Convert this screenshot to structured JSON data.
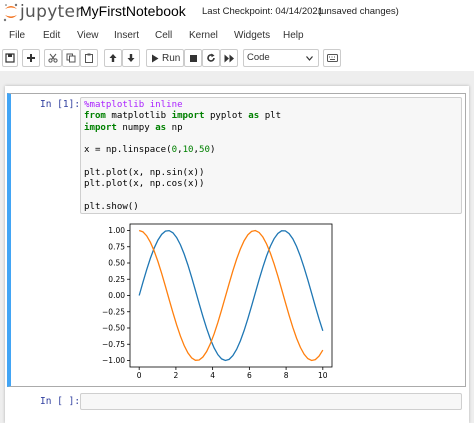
{
  "header": {
    "logo_text": "jupyter",
    "notebook_title": "MyFirstNotebook",
    "checkpoint": "Last Checkpoint: 04/14/2021",
    "save_status": "(unsaved changes)"
  },
  "menu": {
    "items": [
      "File",
      "Edit",
      "View",
      "Insert",
      "Cell",
      "Kernel",
      "Widgets",
      "Help"
    ]
  },
  "toolbar": {
    "run_label": "Run",
    "cell_type": "Code",
    "icons": [
      "save-icon",
      "plus-icon",
      "cut-icon",
      "copy-icon",
      "paste-icon",
      "arrow-up-icon",
      "arrow-down-icon",
      "run-icon",
      "stop-icon",
      "restart-icon",
      "fast-forward-icon",
      "keyboard-icon"
    ]
  },
  "cells": {
    "cell1_prompt": "In [1]:",
    "cell1_code": {
      "line1_magic": "%matplotlib inline",
      "line2_from": "from",
      "line2_mod": " matplotlib ",
      "line2_import": "import",
      "line2_rest": " pyplot ",
      "line2_as": "as",
      "line2_alias": " plt",
      "line3_import": "import",
      "line3_rest": " numpy ",
      "line3_as": "as",
      "line3_alias": " np",
      "line5_a": "x = np.linspace(",
      "line5_b": "0",
      "line5_c": ",",
      "line5_d": "10",
      "line5_e": ",",
      "line5_f": "50",
      "line5_g": ")",
      "line7": "plt.plot(x, np.sin(x))",
      "line8": "plt.plot(x, np.cos(x))",
      "line10": "plt.show()"
    },
    "cell2_prompt": "In [ ]:"
  },
  "chart_data": {
    "type": "line",
    "x_range": [
      0,
      10
    ],
    "x_samples": 50,
    "xticks": [
      0,
      2,
      4,
      6,
      8,
      10
    ],
    "yticks": [
      1.0,
      0.75,
      0.5,
      0.25,
      0.0,
      -0.25,
      -0.5,
      -0.75,
      -1.0
    ],
    "ytick_labels": [
      "1.00",
      "0.75",
      "0.50",
      "0.25",
      "0.00",
      "−0.25",
      "−0.50",
      "−0.75",
      "−1.00"
    ],
    "ylim": [
      -1.1,
      1.1
    ],
    "xlim": [
      -0.5,
      10.5
    ],
    "series": [
      {
        "function": "sin(x)",
        "color": "#1f77b4"
      },
      {
        "function": "cos(x)",
        "color": "#ff7f0e"
      }
    ],
    "title": "",
    "xlabel": "",
    "ylabel": "",
    "grid": false
  },
  "colors": {
    "selected_cell_border": "#42a5f5",
    "prompt": "#303f9f",
    "keyword": "#008000",
    "magic": "#aa22ff"
  }
}
